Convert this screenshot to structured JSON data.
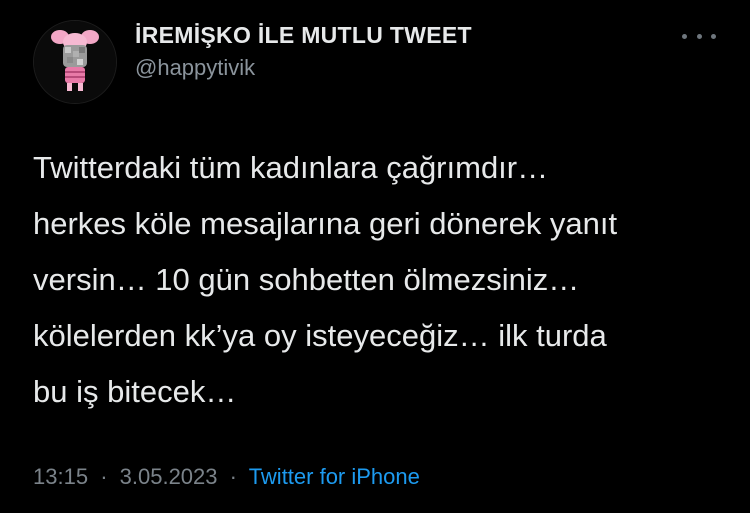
{
  "author": {
    "display_name": "İREMİŞKO İLE MUTLU TWEET",
    "handle": "@happytivik",
    "avatar_icon": "piglet-avatar-icon"
  },
  "tweet": {
    "lines": [
      "Twitterdaki tüm kadınlara çağrımdır…",
      "herkes köle mesajlarına geri dönerek yanıt",
      "versin… 10 gün sohbetten ölmezsiniz…",
      "kölelerden kk’ya oy isteyeceğiz… ilk turda",
      "bu iş bitecek…"
    ]
  },
  "meta": {
    "time": "13:15",
    "date": "3.05.2023",
    "separator": "·",
    "source": "Twitter for iPhone"
  },
  "colors": {
    "background": "#000000",
    "text": "#e7e9ea",
    "secondary": "#7b838a",
    "link": "#1d9bf0"
  }
}
